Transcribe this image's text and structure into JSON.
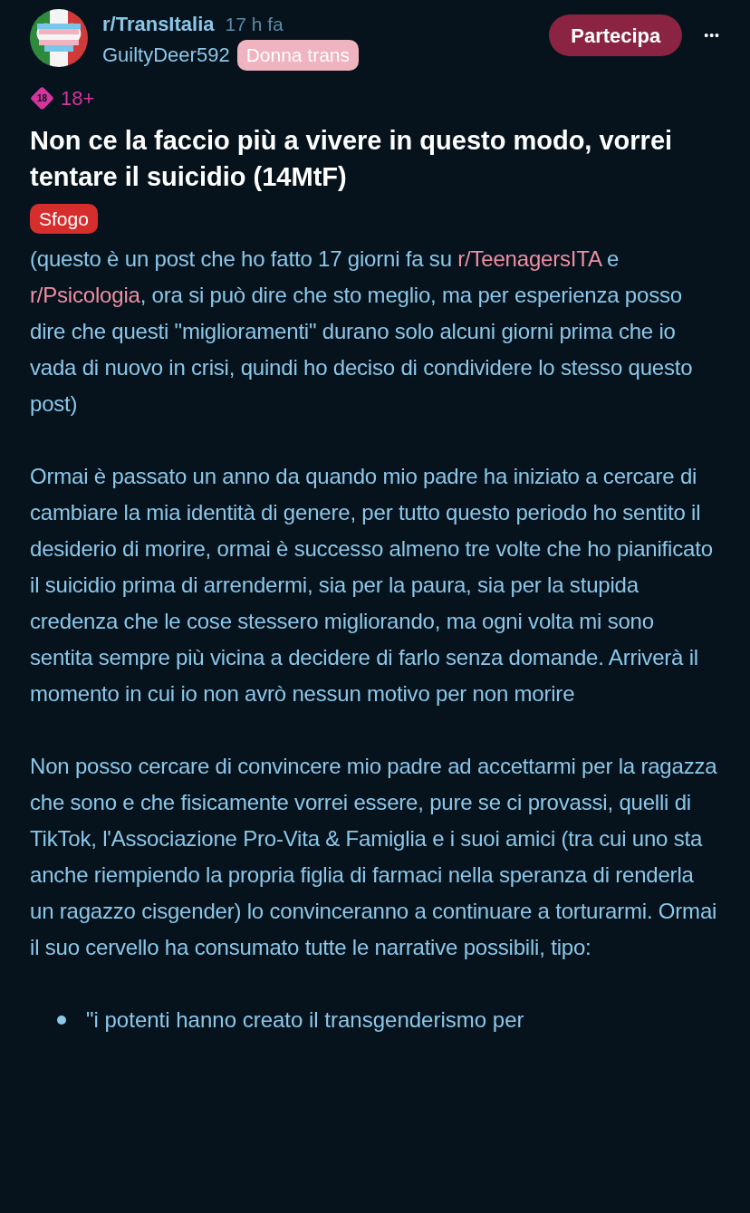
{
  "post": {
    "subreddit": "r/TransItalia",
    "time": "17 h fa",
    "author": "GuiltyDeer592",
    "author_flair": "Donna trans",
    "join_button": "Partecipa",
    "more_button": "•••",
    "nsfw_badge": "18",
    "nsfw_label": "18+",
    "title": "Non ce la faccio più a vivere in questo modo, vorrei tentare il suicidio (14MtF)",
    "flair": "Sfogo",
    "paragraphs": [
      [
        {
          "kind": "text",
          "text": "(questo è un post che ho fatto 17 giorni fa su "
        },
        {
          "kind": "link",
          "text": "r/TeenagersITA"
        },
        {
          "kind": "text",
          "text": " e "
        },
        {
          "kind": "link",
          "text": "r/Psicologia"
        },
        {
          "kind": "text",
          "text": ", ora si può dire che sto meglio, ma per esperienza posso dire che questi \"miglioramenti\" durano solo alcuni giorni prima che io vada di nuovo in crisi, quindi ho deciso di condividere lo stesso questo post)"
        }
      ],
      [
        {
          "kind": "text",
          "text": "Ormai è passato un anno da quando mio padre ha iniziato a cercare di cambiare la mia identità di genere, per tutto questo periodo ho sentito il desiderio di morire, ormai è successo almeno tre volte che ho pianificato il suicidio prima di arrendermi, sia per la paura, sia per la stupida credenza che le cose stessero migliorando, ma ogni volta mi sono sentita sempre più vicina a decidere di farlo senza domande. Arriverà il momento in cui io non avrò nessun motivo per non morire"
        }
      ],
      [
        {
          "kind": "text",
          "text": "Non posso cercare di convincere mio padre ad accettarmi per la ragazza che sono e che fisicamente vorrei essere, pure se ci provassi, quelli di TikTok, l'Associazione Pro-Vita & Famiglia e i suoi amici (tra cui uno sta anche riempiendo la propria figlia di farmaci nella speranza di renderla un ragazzo cisgender) lo convinceranno a continuare a torturarmi. Ormai il suo cervello ha consumato tutte le narrative possibili, tipo:"
        }
      ]
    ],
    "bullets": [
      "\"i potenti hanno creato il transgenderismo per"
    ]
  }
}
